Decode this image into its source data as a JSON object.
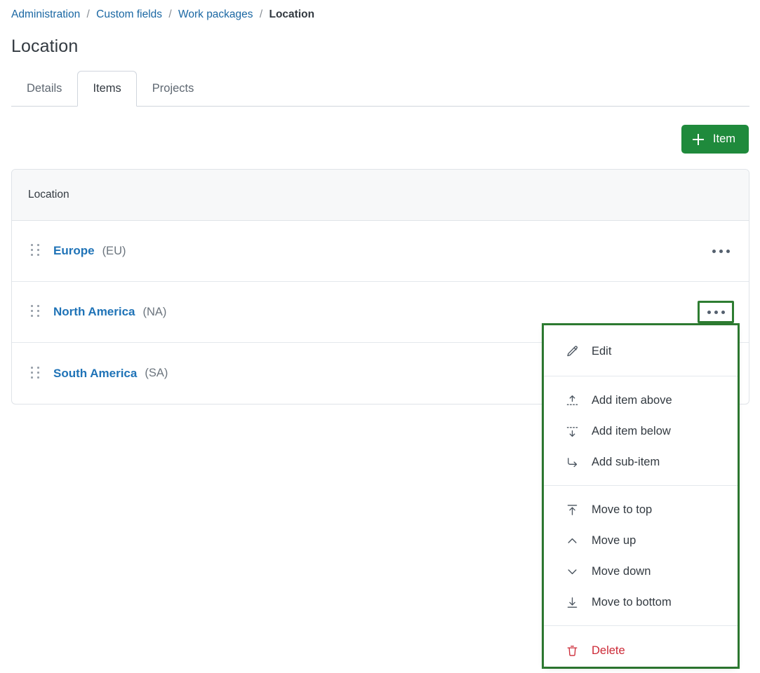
{
  "breadcrumb": {
    "items": [
      {
        "label": "Administration",
        "current": false
      },
      {
        "label": "Custom fields",
        "current": false
      },
      {
        "label": "Work packages",
        "current": false
      },
      {
        "label": "Location",
        "current": true
      }
    ],
    "separator": "/"
  },
  "page": {
    "title": "Location"
  },
  "tabs": [
    {
      "label": "Details",
      "active": false
    },
    {
      "label": "Items",
      "active": true
    },
    {
      "label": "Projects",
      "active": false
    }
  ],
  "toolbar": {
    "add_item_label": "Item",
    "add_item_icon": "plus-icon"
  },
  "table": {
    "header": "Location",
    "rows": [
      {
        "name": "Europe",
        "code": "(EU)",
        "menu_focused": false
      },
      {
        "name": "North America",
        "code": "(NA)",
        "menu_focused": true
      },
      {
        "name": "South America",
        "code": "(SA)",
        "menu_focused": false
      }
    ]
  },
  "menu": {
    "open_for_row": "North America",
    "groups": [
      {
        "name": "edit-group",
        "items": [
          {
            "label": "Edit",
            "icon": "pencil-icon",
            "danger": false
          }
        ]
      },
      {
        "name": "add-group",
        "items": [
          {
            "label": "Add item above",
            "icon": "arrow-up-dotted-icon",
            "danger": false
          },
          {
            "label": "Add item below",
            "icon": "arrow-down-dotted-icon",
            "danger": false
          },
          {
            "label": "Add sub-item",
            "icon": "arrow-turn-down-right-icon",
            "danger": false
          }
        ]
      },
      {
        "name": "move-group",
        "items": [
          {
            "label": "Move to top",
            "icon": "arrow-to-top-icon",
            "danger": false
          },
          {
            "label": "Move up",
            "icon": "chevron-up-icon",
            "danger": false
          },
          {
            "label": "Move down",
            "icon": "chevron-down-icon",
            "danger": false
          },
          {
            "label": "Move to bottom",
            "icon": "arrow-to-bottom-icon",
            "danger": false
          }
        ]
      },
      {
        "name": "delete-group",
        "items": [
          {
            "label": "Delete",
            "icon": "trash-icon",
            "danger": true
          }
        ]
      }
    ]
  },
  "colors": {
    "accent_green": "#1f8a3c",
    "focus_green": "#2e7d32",
    "link_blue": "#1f73b7",
    "breadcrumb_blue": "#1a67a3",
    "danger_red": "#cc2936",
    "header_bg": "#f7f8f9",
    "border": "#dfe3e8"
  }
}
